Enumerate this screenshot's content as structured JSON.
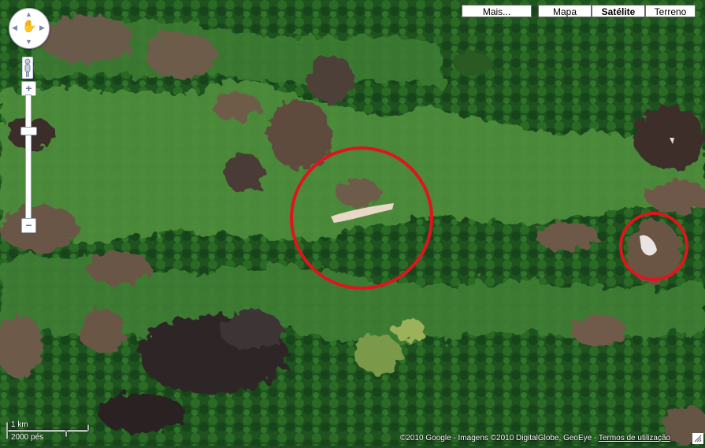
{
  "map": {
    "type": "satellite",
    "overlays": [
      "red-circle",
      "red-circle"
    ]
  },
  "controls": {
    "zoom_in": "+",
    "zoom_out": "−",
    "map_types": {
      "more": "Mais...",
      "map": "Mapa",
      "satellite": "Satélite",
      "terrain": "Terreno",
      "active": "satellite"
    }
  },
  "scale": {
    "km": "1 km",
    "ft": "2000 pés"
  },
  "footer": {
    "copyright": "©2010 Google - Imagens ©2010 DigitalGlobe, GeoEye - ",
    "terms": "Termos de utilização"
  },
  "colors": {
    "overlay_circle": "#e0141e"
  }
}
